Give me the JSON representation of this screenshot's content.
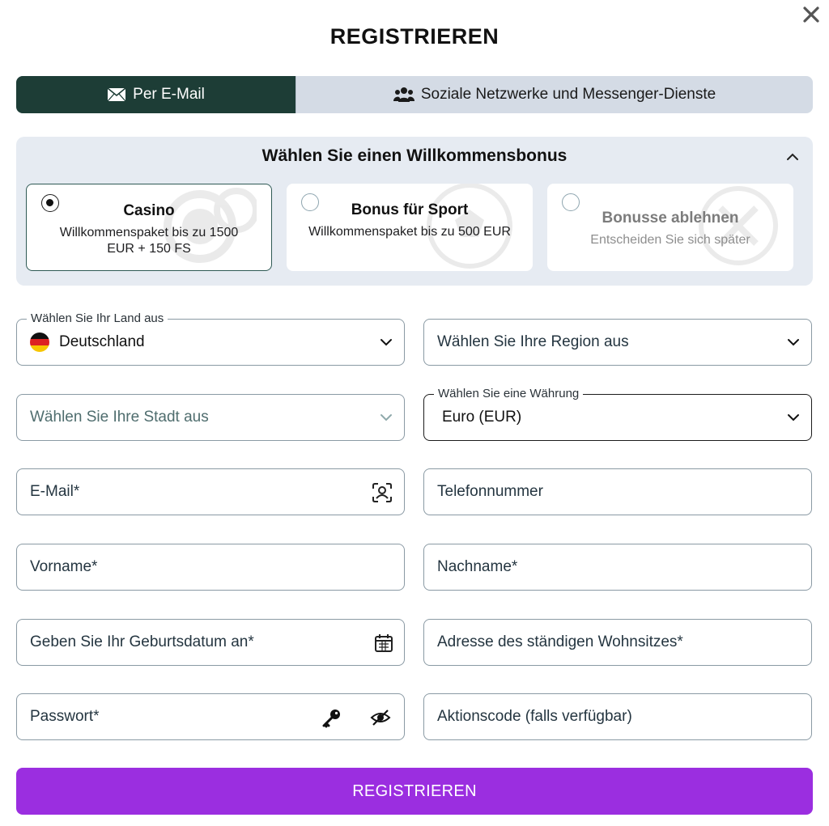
{
  "dialog": {
    "title": "REGISTRIEREN",
    "close_icon": "close-icon"
  },
  "tabs": [
    {
      "label": "Per E-Mail",
      "icon": "envelope-icon",
      "active": true
    },
    {
      "label": "Soziale Netzwerke und Messenger-Dienste",
      "icon": "users-icon",
      "active": false
    }
  ],
  "bonus": {
    "title": "Wählen Sie einen Willkommensbonus",
    "expanded": true,
    "options": [
      {
        "title": "Casino",
        "description": "Willkommenspaket bis zu 1500 EUR + 150 FS",
        "selected": true,
        "icon": "casino-chip-icon"
      },
      {
        "title": "Bonus für Sport",
        "description": "Willkommenspaket bis zu 500 EUR",
        "selected": false,
        "icon": "soccer-ball-icon"
      },
      {
        "title": "Bonusse ablehnen",
        "description": "Entscheiden Sie sich später",
        "selected": false,
        "icon": "decline-x-icon"
      }
    ]
  },
  "form": {
    "country": {
      "legend": "Wählen Sie Ihr Land aus",
      "value": "Deutschland",
      "flag": "de"
    },
    "region": {
      "placeholder": "Wählen Sie Ihre Region aus"
    },
    "city": {
      "placeholder": "Wählen Sie Ihre Stadt aus"
    },
    "currency": {
      "legend": "Wählen Sie eine Währung",
      "value": "Euro (EUR)"
    },
    "email": {
      "placeholder": "E-Mail*"
    },
    "phone": {
      "placeholder": "Telefonnummer"
    },
    "first_name": {
      "placeholder": "Vorname*"
    },
    "last_name": {
      "placeholder": "Nachname*"
    },
    "birthdate": {
      "placeholder": "Geben Sie Ihr Geburtsdatum an*"
    },
    "address": {
      "placeholder": "Adresse des ständigen Wohnsitzes*"
    },
    "password": {
      "placeholder": "Passwort*"
    },
    "promo": {
      "placeholder": "Aktionscode (falls verfügbar)"
    }
  },
  "submit_label": "REGISTRIEREN",
  "colors": {
    "tab_active": "#1d3d36",
    "tab_inactive": "#d4dbe5",
    "bonus_bg": "#e6ebf2",
    "submit": "#9b2ee0"
  }
}
